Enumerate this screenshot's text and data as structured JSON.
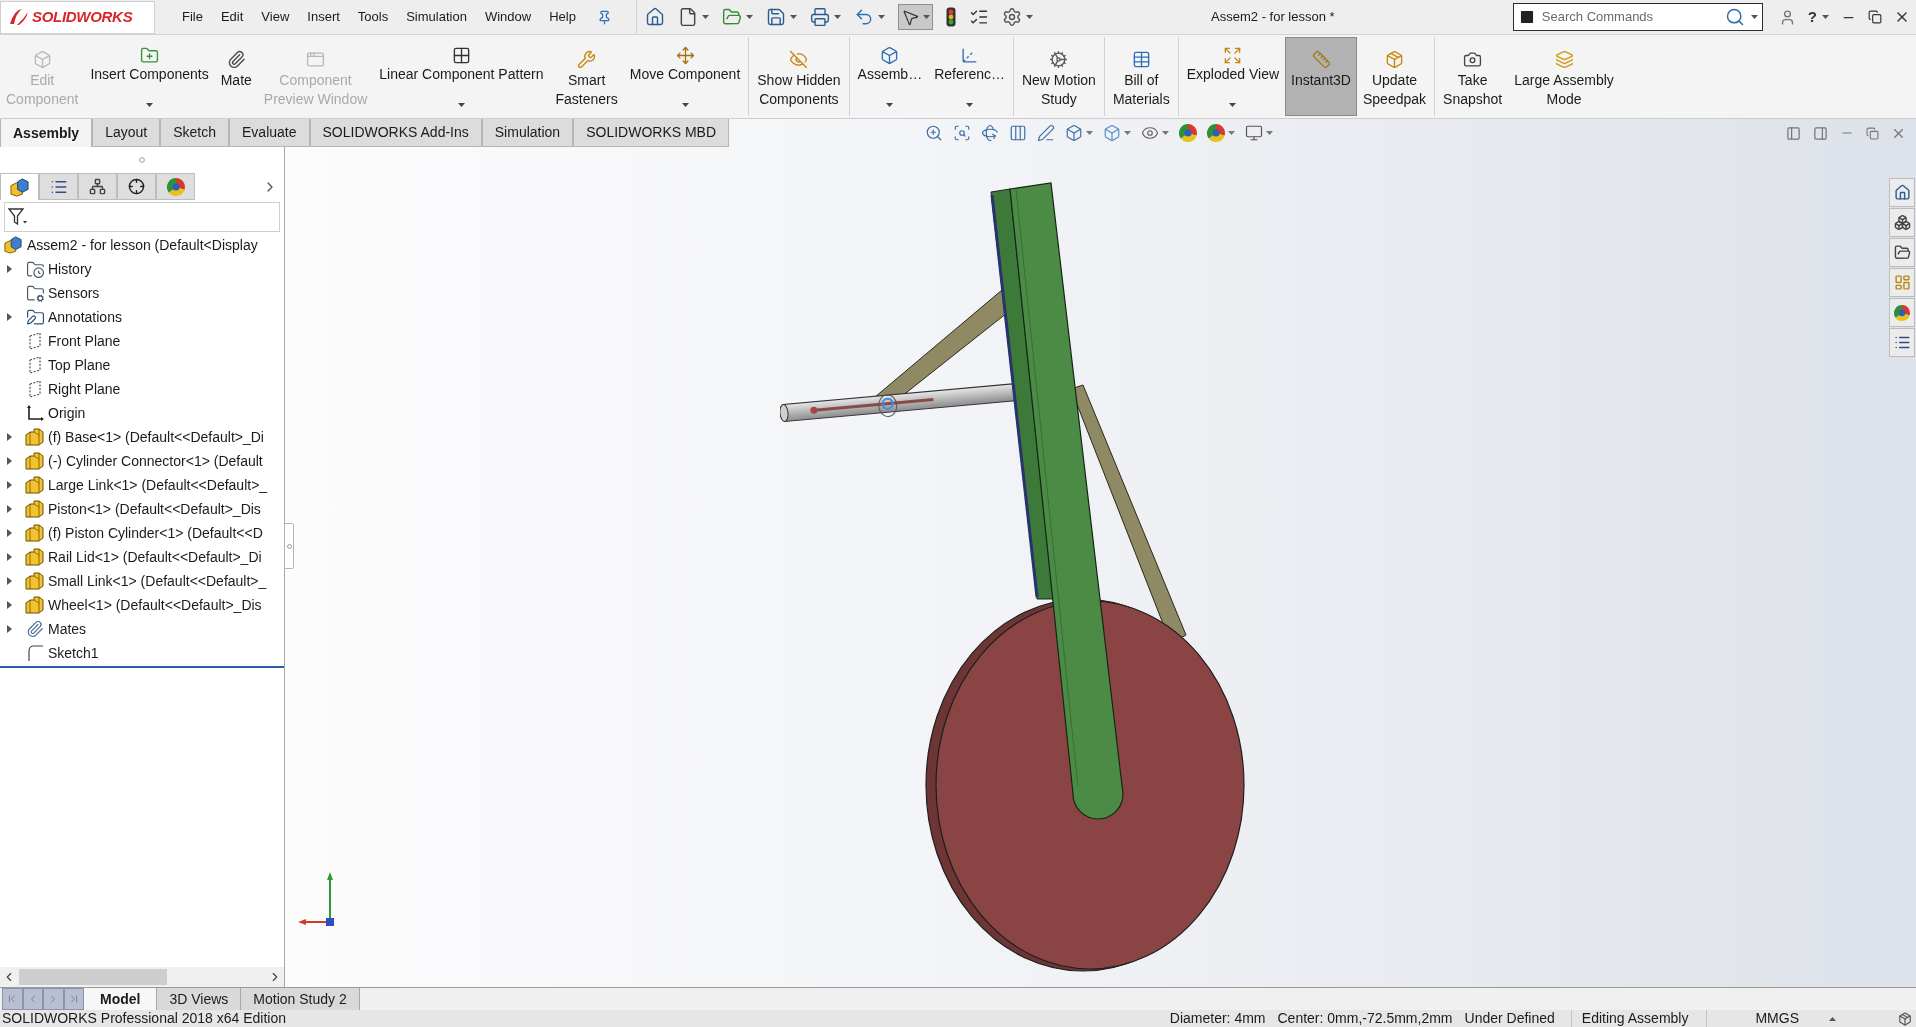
{
  "title_bar": {
    "logo_text": "SOLIDWORKS",
    "menu": [
      "File",
      "Edit",
      "View",
      "Insert",
      "Tools",
      "Simulation",
      "Window",
      "Help"
    ],
    "select_tool_active": true,
    "document_title": "Assem2 - for lesson *",
    "search": {
      "placeholder": "Search Commands"
    },
    "help_label": "?"
  },
  "command_manager": {
    "groups": [
      [
        {
          "kind": "stacked",
          "label_lines": [
            "Edit",
            "Component"
          ],
          "disabled": true,
          "pressed": false
        },
        {
          "kind": "split",
          "label_lines": [
            "Insert Components"
          ],
          "disabled": false,
          "pressed": false
        },
        {
          "kind": "stacked",
          "label_lines": [
            "Mate"
          ],
          "disabled": false,
          "pressed": false
        },
        {
          "kind": "stacked",
          "label_lines": [
            "Component",
            "Preview Window"
          ],
          "disabled": true,
          "pressed": false
        },
        {
          "kind": "split",
          "label_lines": [
            "Linear Component Pattern"
          ],
          "disabled": false,
          "pressed": false
        },
        {
          "kind": "stacked",
          "label_lines": [
            "Smart",
            "Fasteners"
          ],
          "disabled": false,
          "pressed": false
        },
        {
          "kind": "split",
          "label_lines": [
            "Move Component"
          ],
          "disabled": false,
          "pressed": false
        }
      ],
      [
        {
          "kind": "stacked",
          "label_lines": [
            "Show Hidden",
            "Components"
          ],
          "disabled": false,
          "pressed": false
        }
      ],
      [
        {
          "kind": "split",
          "label_lines": [
            "Assemb…"
          ],
          "disabled": false,
          "pressed": false
        },
        {
          "kind": "split",
          "label_lines": [
            "Referenc…"
          ],
          "disabled": false,
          "pressed": false
        }
      ],
      [
        {
          "kind": "stacked",
          "label_lines": [
            "New Motion",
            "Study"
          ],
          "disabled": false,
          "pressed": false
        }
      ],
      [
        {
          "kind": "stacked",
          "label_lines": [
            "Bill of",
            "Materials"
          ],
          "disabled": false,
          "pressed": false
        }
      ],
      [
        {
          "kind": "split",
          "label_lines": [
            "Exploded View"
          ],
          "disabled": false,
          "pressed": false
        },
        {
          "kind": "stacked",
          "label_lines": [
            "Instant3D"
          ],
          "disabled": false,
          "pressed": true
        },
        {
          "kind": "stacked",
          "label_lines": [
            "Update",
            "Speedpak"
          ],
          "disabled": false,
          "pressed": false
        }
      ],
      [
        {
          "kind": "stacked",
          "label_lines": [
            "Take",
            "Snapshot"
          ],
          "disabled": false,
          "pressed": false
        },
        {
          "kind": "stacked",
          "label_lines": [
            "Large Assembly",
            "Mode"
          ],
          "disabled": false,
          "pressed": false
        }
      ]
    ]
  },
  "tabs": [
    {
      "label": "Assembly",
      "selected": true
    },
    {
      "label": "Layout",
      "selected": false
    },
    {
      "label": "Sketch",
      "selected": false
    },
    {
      "label": "Evaluate",
      "selected": false
    },
    {
      "label": "SOLIDWORKS Add-Ins",
      "selected": false
    },
    {
      "label": "Simulation",
      "selected": false
    },
    {
      "label": "SOLIDWORKS MBD",
      "selected": false
    }
  ],
  "feature_manager": {
    "tabs": [
      {
        "kind": "features",
        "selected": true
      },
      {
        "kind": "properties",
        "selected": false
      },
      {
        "kind": "configurations",
        "selected": false
      },
      {
        "kind": "dimxpert",
        "selected": false
      },
      {
        "kind": "display",
        "selected": false
      }
    ],
    "tree": {
      "label": "Assem2 - for lesson (Default<Display",
      "kind": "assembly",
      "expander": false,
      "children": [
        {
          "label": "History",
          "kind": "history",
          "expander": true
        },
        {
          "label": "Sensors",
          "kind": "sensors",
          "expander": false
        },
        {
          "label": "Annotations",
          "kind": "annotations",
          "expander": true
        },
        {
          "label": "Front Plane",
          "kind": "plane",
          "expander": false
        },
        {
          "label": "Top Plane",
          "kind": "plane",
          "expander": false
        },
        {
          "label": "Right Plane",
          "kind": "plane",
          "expander": false
        },
        {
          "label": "Origin",
          "kind": "origin",
          "expander": false
        },
        {
          "label": "(f) Base<1> (Default<<Default>_Di",
          "kind": "part",
          "expander": true
        },
        {
          "label": "(-) Cylinder Connector<1> (Default",
          "kind": "part",
          "expander": true
        },
        {
          "label": "Large Link<1> (Default<<Default>_",
          "kind": "part",
          "expander": true
        },
        {
          "label": "Piston<1> (Default<<Default>_Dis",
          "kind": "part",
          "expander": true
        },
        {
          "label": "(f) Piston Cylinder<1> (Default<<D",
          "kind": "part",
          "expander": true
        },
        {
          "label": "Rail Lid<1> (Default<<Default>_Di",
          "kind": "part",
          "expander": true
        },
        {
          "label": "Small Link<1> (Default<<Default>_",
          "kind": "part",
          "expander": true
        },
        {
          "label": "Wheel<1> (Default<<Default>_Dis",
          "kind": "part",
          "expander": true
        },
        {
          "label": "Mates",
          "kind": "mates",
          "expander": true
        },
        {
          "label": "Sketch1",
          "kind": "sketch",
          "expander": false
        }
      ]
    }
  },
  "bottom_tabs": [
    {
      "label": "Model",
      "selected": true
    },
    {
      "label": "3D Views",
      "selected": false
    },
    {
      "label": "Motion Study 2",
      "selected": false
    }
  ],
  "status_bar": {
    "product": "SOLIDWORKS Professional 2018 x64 Edition",
    "readouts": [
      "Diameter: 4mm",
      "Center: 0mm,-72.5mm,2mm",
      "Under Defined"
    ],
    "mode": "Editing Assembly",
    "units": "MMGS"
  }
}
